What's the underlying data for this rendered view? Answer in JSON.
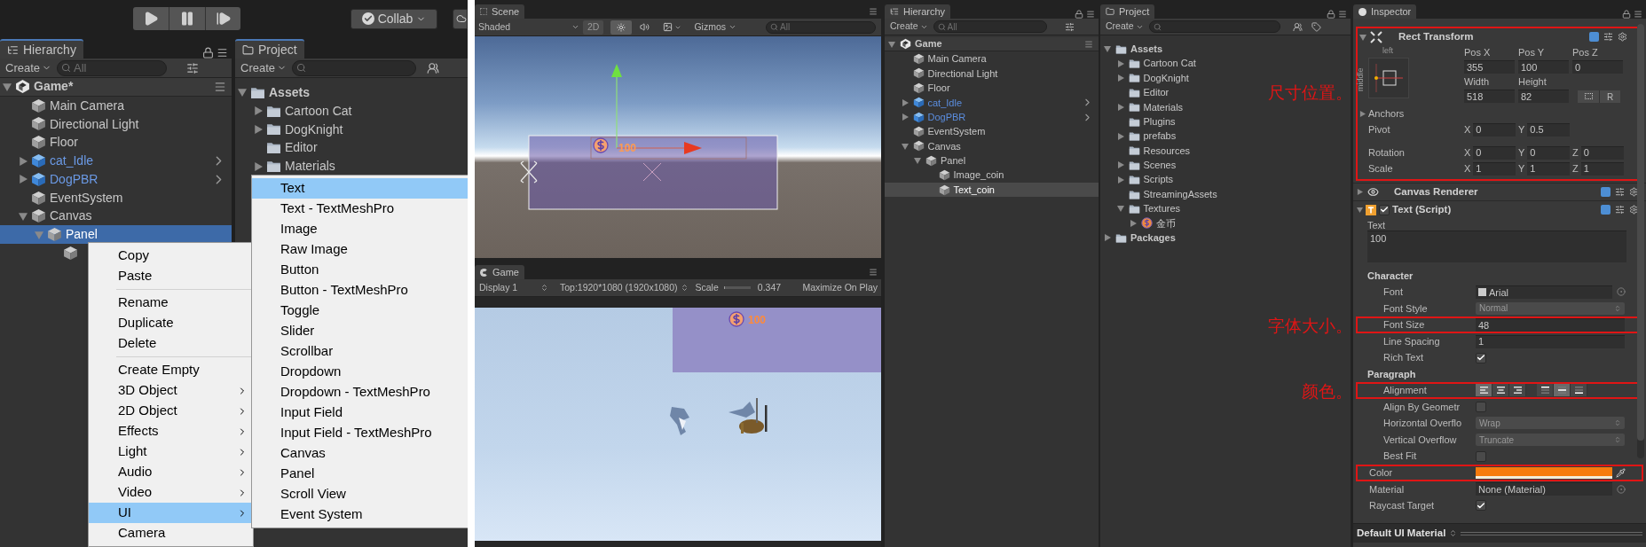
{
  "left_shot": {
    "toolbar": {
      "collab": "Collab"
    },
    "hierarchy": {
      "title": "Hierarchy",
      "create": "Create",
      "search_placeholder": "All",
      "tree": [
        {
          "name": "Game*",
          "kind": "scene",
          "selected": false,
          "expanded": true,
          "children": [
            {
              "name": "Main Camera",
              "kind": "object",
              "selected": false
            },
            {
              "name": "Directional Light",
              "kind": "object",
              "selected": false
            },
            {
              "name": "Floor",
              "kind": "object",
              "selected": false
            },
            {
              "name": "cat_Idle",
              "kind": "prefab",
              "selected": false,
              "expanded": false
            },
            {
              "name": "DogPBR",
              "kind": "prefab",
              "selected": false,
              "expanded": false
            },
            {
              "name": "EventSystem",
              "kind": "object",
              "selected": false
            },
            {
              "name": "Canvas",
              "kind": "object",
              "selected": false,
              "expanded": true,
              "children": [
                {
                  "name": "Panel",
                  "kind": "object",
                  "selected": true,
                  "expanded": true,
                  "children": [
                    {
                      "kind": "object",
                      "selected": false
                    }
                  ]
                }
              ]
            }
          ]
        }
      ]
    },
    "project": {
      "title": "Project",
      "create": "Create",
      "tree": [
        {
          "name": "Assets",
          "kind": "folder",
          "selected": false,
          "expanded": true,
          "children": [
            {
              "name": "Cartoon Cat",
              "kind": "folder",
              "selected": false,
              "expanded": false
            },
            {
              "name": "DogKnight",
              "kind": "folder",
              "selected": false,
              "expanded": false
            },
            {
              "name": "Editor",
              "kind": "folder",
              "selected": false
            },
            {
              "name": "Materials",
              "kind": "folder",
              "selected": false,
              "expanded": false
            }
          ]
        }
      ]
    },
    "context_menu": {
      "groups": [
        [
          {
            "label": "Copy",
            "selected": false,
            "submenu": false
          },
          {
            "label": "Paste",
            "selected": false,
            "submenu": false
          }
        ],
        [
          {
            "label": "Rename",
            "selected": false,
            "submenu": false
          },
          {
            "label": "Duplicate",
            "selected": false,
            "submenu": false
          },
          {
            "label": "Delete",
            "selected": false,
            "submenu": false
          }
        ],
        [
          {
            "label": "Create Empty",
            "selected": false,
            "submenu": false
          },
          {
            "label": "3D Object",
            "selected": false,
            "submenu": true
          },
          {
            "label": "2D Object",
            "selected": false,
            "submenu": true
          },
          {
            "label": "Effects",
            "selected": false,
            "submenu": true
          },
          {
            "label": "Light",
            "selected": false,
            "submenu": true
          },
          {
            "label": "Audio",
            "selected": false,
            "submenu": true
          },
          {
            "label": "Video",
            "selected": false,
            "submenu": true
          },
          {
            "label": "UI",
            "selected": true,
            "submenu": true
          },
          {
            "label": "Camera",
            "selected": false,
            "submenu": false
          }
        ]
      ]
    },
    "submenu": {
      "items": [
        {
          "label": "Text",
          "selected": true
        },
        {
          "label": "Text - TextMeshPro",
          "selected": false
        },
        {
          "label": "Image",
          "selected": false
        },
        {
          "label": "Raw Image",
          "selected": false
        },
        {
          "label": "Button",
          "selected": false
        },
        {
          "label": "Button - TextMeshPro",
          "selected": false
        },
        {
          "label": "Toggle",
          "selected": false
        },
        {
          "label": "Slider",
          "selected": false
        },
        {
          "label": "Scrollbar",
          "selected": false
        },
        {
          "label": "Dropdown",
          "selected": false
        },
        {
          "label": "Dropdown - TextMeshPro",
          "selected": false
        },
        {
          "label": "Input Field",
          "selected": false
        },
        {
          "label": "Input Field - TextMeshPro",
          "selected": false
        },
        {
          "label": "Canvas",
          "selected": false
        },
        {
          "label": "Panel",
          "selected": false
        },
        {
          "label": "Scroll View",
          "selected": false
        },
        {
          "label": "Event System",
          "selected": false
        }
      ]
    }
  },
  "right_shot": {
    "scene": {
      "title": "Scene",
      "shading": "Shaded",
      "mode_2d": "2D",
      "lighting_on": true,
      "gizmos": "Gizmos",
      "search_placeholder": "All",
      "coin_text": "100"
    },
    "game": {
      "title": "Game",
      "display": "Display 1",
      "resolution": "Top:1920*1080 (1920x1080)",
      "scale_label": "Scale",
      "scale": {
        "level": 0.05
      },
      "scale_value": "0.347",
      "maximize": "Maximize On Play",
      "coin_text": "100"
    },
    "hierarchy": {
      "title": "Hierarchy",
      "create": "Create",
      "search_placeholder": "All",
      "tree": [
        {
          "name": "Game",
          "kind": "scene",
          "selected": false,
          "expanded": true,
          "children": [
            {
              "name": "Main Camera",
              "kind": "object",
              "selected": false
            },
            {
              "name": "Directional Light",
              "kind": "object",
              "selected": false
            },
            {
              "name": "Floor",
              "kind": "object",
              "selected": false
            },
            {
              "name": "cat_Idle",
              "kind": "prefab",
              "selected": false,
              "expanded": false
            },
            {
              "name": "DogPBR",
              "kind": "prefab",
              "selected": false,
              "expanded": false
            },
            {
              "name": "EventSystem",
              "kind": "object",
              "selected": false
            },
            {
              "name": "Canvas",
              "kind": "object",
              "selected": false,
              "expanded": true,
              "children": [
                {
                  "name": "Panel",
                  "kind": "object",
                  "selected": false,
                  "expanded": true,
                  "children": [
                    {
                      "name": "Image_coin",
                      "kind": "object",
                      "selected": false
                    },
                    {
                      "name": "Text_coin",
                      "kind": "object",
                      "selected": true
                    }
                  ]
                }
              ]
            }
          ]
        }
      ]
    },
    "project": {
      "title": "Project",
      "create": "Create",
      "tree": [
        {
          "name": "Assets",
          "kind": "folder",
          "selected": false,
          "expanded": true,
          "children": [
            {
              "name": "Cartoon Cat",
              "kind": "folder",
              "selected": false,
              "expanded": false
            },
            {
              "name": "DogKnight",
              "kind": "folder",
              "selected": false,
              "expanded": false
            },
            {
              "name": "Editor",
              "kind": "folder",
              "selected": false
            },
            {
              "name": "Materials",
              "kind": "folder",
              "selected": false,
              "expanded": false
            },
            {
              "name": "Plugins",
              "kind": "folder",
              "selected": false
            },
            {
              "name": "prefabs",
              "kind": "folder",
              "selected": false,
              "expanded": false
            },
            {
              "name": "Resources",
              "kind": "folder",
              "selected": false
            },
            {
              "name": "Scenes",
              "kind": "folder",
              "selected": false,
              "expanded": false
            },
            {
              "name": "Scripts",
              "kind": "folder",
              "selected": false,
              "expanded": false
            },
            {
              "name": "StreamingAssets",
              "kind": "folder",
              "selected": false
            },
            {
              "name": "Textures",
              "kind": "folder",
              "selected": false,
              "expanded": true,
              "children": [
                {
                  "name": "金币",
                  "kind": "coin",
                  "selected": false,
                  "expanded": false
                }
              ]
            }
          ]
        },
        {
          "name": "Packages",
          "kind": "folder",
          "selected": false,
          "expanded": false
        }
      ]
    },
    "inspector": {
      "title": "Inspector",
      "rect_transform": {
        "title": "Rect Transform",
        "expanded": true,
        "highlighted": true,
        "note": "尺寸位置。",
        "anchor_h": "left",
        "anchor_v": "middle",
        "position": [
          {
            "label": "Pos X",
            "value": "355"
          },
          {
            "label": "Pos Y",
            "value": "100"
          },
          {
            "label": "Pos Z",
            "value": "0"
          }
        ],
        "size": [
          {
            "label": "Width",
            "value": "518"
          },
          {
            "label": "Height",
            "value": "82"
          }
        ],
        "reset": "R",
        "anchors": {
          "label": "Anchors",
          "expanded": false
        },
        "rows": [
          {
            "label": "Pivot",
            "axes": [
              {
                "axis": "X",
                "value": "0"
              },
              {
                "axis": "Y",
                "value": "0.5"
              }
            ]
          },
          {
            "label": "Rotation",
            "axes": [
              {
                "axis": "X",
                "value": "0"
              },
              {
                "axis": "Y",
                "value": "0"
              },
              {
                "axis": "Z",
                "value": "0"
              }
            ]
          },
          {
            "label": "Scale",
            "axes": [
              {
                "axis": "X",
                "value": "1"
              },
              {
                "axis": "Y",
                "value": "1"
              },
              {
                "axis": "Z",
                "value": "1"
              }
            ]
          }
        ]
      },
      "canvas_renderer": {
        "title": "Canvas Renderer",
        "expanded": false
      },
      "text_component": {
        "title": "Text (Script)",
        "enabled": true,
        "expanded": true,
        "text_label": "Text",
        "text_value": "100",
        "sections": [
          {
            "title": "Character",
            "fields": [
              {
                "kind": "object",
                "label": "Font",
                "value": "Arial",
                "highlighted": false
              },
              {
                "kind": "dropdown",
                "label": "Font Style",
                "value": "Normal",
                "highlighted": false
              },
              {
                "kind": "number",
                "label": "Font Size",
                "value": "48",
                "highlighted": true,
                "note": "字体大小。"
              },
              {
                "kind": "number",
                "label": "Line Spacing",
                "value": "1",
                "highlighted": false
              },
              {
                "kind": "checkbox",
                "label": "Rich Text",
                "checked": true,
                "highlighted": false
              }
            ]
          },
          {
            "title": "Paragraph",
            "fields": [
              {
                "kind": "alignment",
                "label": "Alignment",
                "highlighted": true,
                "note": "颜色。",
                "horizontal": [
                  {
                    "selected": true
                  },
                  {
                    "selected": false
                  },
                  {
                    "selected": false
                  }
                ],
                "vertical": [
                  {
                    "selected": false
                  },
                  {
                    "selected": true
                  },
                  {
                    "selected": false
                  }
                ]
              },
              {
                "kind": "checkbox",
                "label": "Align By Geometr",
                "checked": false,
                "highlighted": false
              },
              {
                "kind": "dropdown",
                "label": "Horizontal Overflo",
                "value": "Wrap",
                "highlighted": false
              },
              {
                "kind": "dropdown",
                "label": "Vertical Overflow",
                "value": "Truncate",
                "highlighted": false
              },
              {
                "kind": "checkbox",
                "label": "Best Fit",
                "checked": false,
                "highlighted": false
              }
            ]
          }
        ],
        "fields": [
          {
            "kind": "color",
            "label": "Color",
            "color": "#f77b0c",
            "highlighted": true
          },
          {
            "kind": "object",
            "label": "Material",
            "value": "None (Material)",
            "highlighted": false
          },
          {
            "kind": "checkbox",
            "label": "Raycast Target",
            "checked": true,
            "highlighted": false
          }
        ]
      },
      "material_footer": "Default UI Material"
    }
  }
}
